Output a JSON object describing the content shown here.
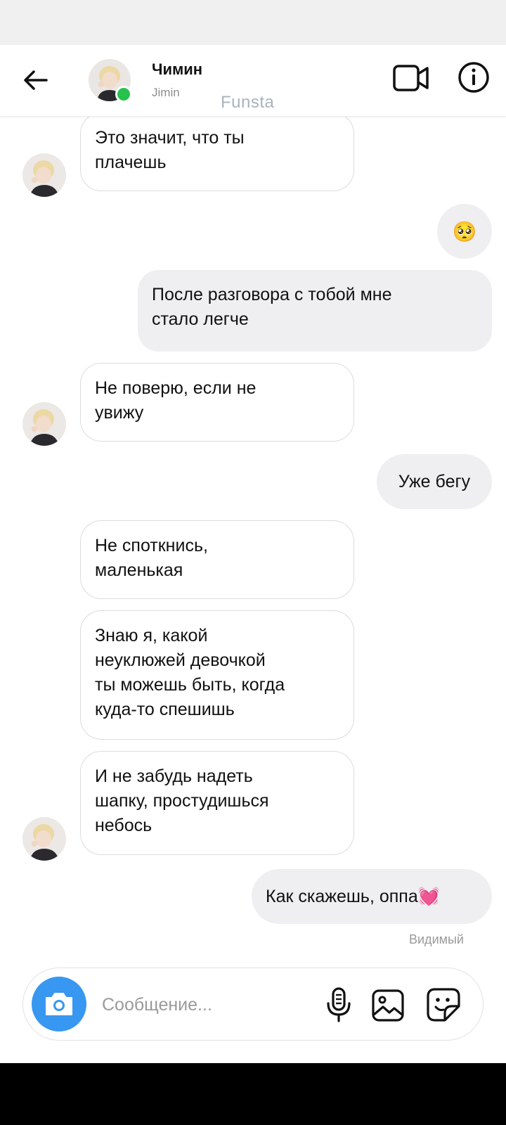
{
  "header": {
    "name": "Чимин",
    "username": "Jimin",
    "watermark": "Funsta"
  },
  "messages": [
    {
      "side": "in",
      "text": "Это значит, что ты\nплачешь"
    },
    {
      "side": "out",
      "text": "🥺"
    },
    {
      "side": "out",
      "text": "После разговора с тобой мне\nстало легче"
    },
    {
      "side": "in",
      "text": "Не поверю, если не\nувижу"
    },
    {
      "side": "out",
      "text": "Уже бегу"
    },
    {
      "side": "in",
      "text": "Не споткнись,\nмаленькая"
    },
    {
      "side": "in",
      "text": "Знаю я, какой\nнеуклюжей девочкой\nты можешь быть, когда\nкуда-то спешишь"
    },
    {
      "side": "in",
      "text": "И не забудь надеть\nшапку, простудишься\nнебось"
    },
    {
      "side": "out",
      "text": "Как скажешь, оппа💓"
    }
  ],
  "status": {
    "seen": "Видимый"
  },
  "composer": {
    "placeholder": "Сообщение..."
  },
  "colors": {
    "online": "#27c24c",
    "camera_button": "#3897f0",
    "outgoing_bubble": "#efeef1",
    "incoming_border": "#dcdcdc"
  },
  "icons": [
    "back-arrow-icon",
    "video-call-icon",
    "info-icon",
    "camera-icon",
    "microphone-icon",
    "gallery-icon",
    "sticker-icon"
  ]
}
